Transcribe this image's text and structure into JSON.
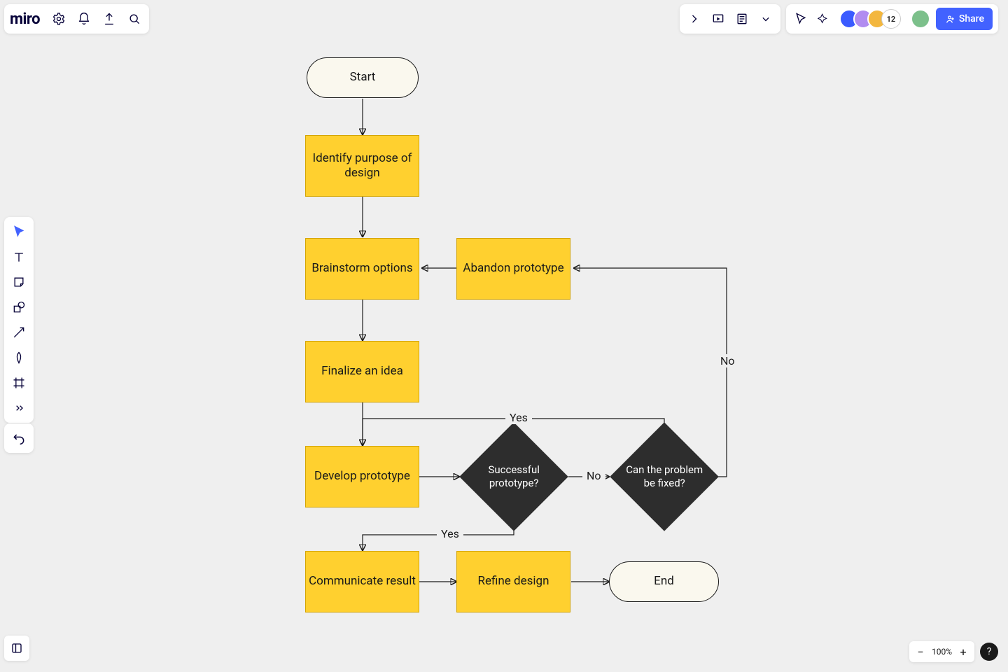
{
  "app": {
    "logo": "miro"
  },
  "topright": {
    "participant_count": "12",
    "share_label": "Share"
  },
  "zoom": {
    "level": "100%",
    "help": "?",
    "minus": "−",
    "plus": "+"
  },
  "flow": {
    "start": "Start",
    "identify": "Identify purpose of design",
    "brainstorm": "Brainstorm options",
    "abandon": "Abandon prototype",
    "finalize": "Finalize an idea",
    "develop": "Develop prototype",
    "successful_q": "Successful prototype?",
    "fix_q": "Can the problem be fixed?",
    "communicate": "Communicate result",
    "refine": "Refine design",
    "end": "End",
    "labels": {
      "yes": "Yes",
      "no": "No"
    }
  }
}
